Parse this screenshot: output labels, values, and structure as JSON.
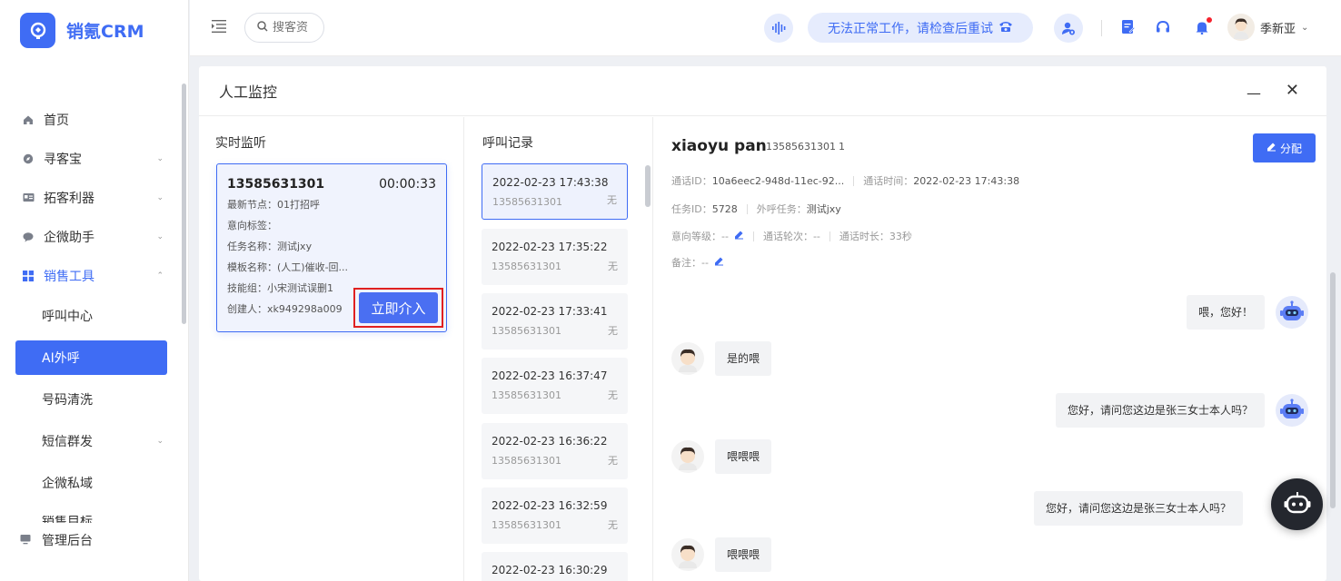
{
  "app": {
    "logo_text": "销氪CRM"
  },
  "sidebar": {
    "items": [
      {
        "label": "首页",
        "icon": "home-icon"
      },
      {
        "label": "寻客宝",
        "icon": "compass-icon",
        "expandable": true
      },
      {
        "label": "拓客利器",
        "icon": "id-card-icon",
        "expandable": true
      },
      {
        "label": "企微助手",
        "icon": "chat-icon",
        "expandable": true
      },
      {
        "label": "销售工具",
        "icon": "grid-icon",
        "expandable": true,
        "expanded": true
      }
    ],
    "sub_items": [
      {
        "label": "呼叫中心",
        "active": false
      },
      {
        "label": "AI外呼",
        "active": true
      },
      {
        "label": "号码清洗",
        "active": false
      },
      {
        "label": "短信群发",
        "active": false,
        "expandable": true
      },
      {
        "label": "企微私域",
        "active": false
      }
    ],
    "clipped_item": "销售目标",
    "bottom_item": {
      "label": "管理后台",
      "icon": "monitor-icon"
    }
  },
  "topbar": {
    "search_placeholder": "搜客资",
    "status_text": "无法正常工作，请检查后重试",
    "user_name": "季新亚"
  },
  "panel": {
    "title": "人工监控",
    "live": {
      "title": "实时监听",
      "phone": "13585631301",
      "duration": "00:00:33",
      "fields": [
        "最新节点：01打招呼",
        "意向标签：",
        "任务名称：测试jxy",
        "模板名称：(人工)催收-回...",
        "技能组：小宋测试误删1",
        "创建人：xk949298a009"
      ],
      "intervene_label": "立即介入"
    },
    "records": {
      "title": "呼叫记录",
      "items": [
        {
          "time": "2022-02-23 17:43:38",
          "phone": "13585631301",
          "flag": "无"
        },
        {
          "time": "2022-02-23 17:35:22",
          "phone": "13585631301",
          "flag": "无"
        },
        {
          "time": "2022-02-23 17:33:41",
          "phone": "13585631301",
          "flag": "无"
        },
        {
          "time": "2022-02-23 16:37:47",
          "phone": "13585631301",
          "flag": "无"
        },
        {
          "time": "2022-02-23 16:36:22",
          "phone": "13585631301",
          "flag": "无"
        },
        {
          "time": "2022-02-23 16:32:59",
          "phone": "13585631301",
          "flag": "无"
        },
        {
          "time": "2022-02-23 16:30:29",
          "phone": "",
          "flag": ""
        }
      ]
    },
    "detail": {
      "name": "xiaoyu pan",
      "phone": "13585631301",
      "count": "1",
      "assign_label": "分配",
      "call_id_label": "通话ID：",
      "call_id": "10a6eec2-948d-11ec-92...",
      "call_time_label": "通话时间：",
      "call_time": "2022-02-23 17:43:38",
      "task_id_label": "任务ID：",
      "task_id": "5728",
      "task_name_label": "外呼任务：",
      "task_name": "测试jxy",
      "intent_label": "意向等级：",
      "intent": "--",
      "rounds_label": "通话轮次：",
      "rounds": "--",
      "duration_label": "通话时长：",
      "duration": "33秒",
      "note_label": "备注：",
      "note": "--",
      "messages": [
        {
          "from": "bot",
          "text": "喂，您好！"
        },
        {
          "from": "user",
          "text": "是的喂"
        },
        {
          "from": "bot",
          "text": "您好，请问您这边是张三女士本人吗？"
        },
        {
          "from": "user",
          "text": "喂喂喂"
        },
        {
          "from": "bot",
          "text": "您好，请问您这边是张三女士本人吗？"
        },
        {
          "from": "user",
          "text": "喂喂喂"
        }
      ]
    }
  },
  "colors": {
    "primary": "#3f6cf4",
    "highlight": "#e02020"
  }
}
